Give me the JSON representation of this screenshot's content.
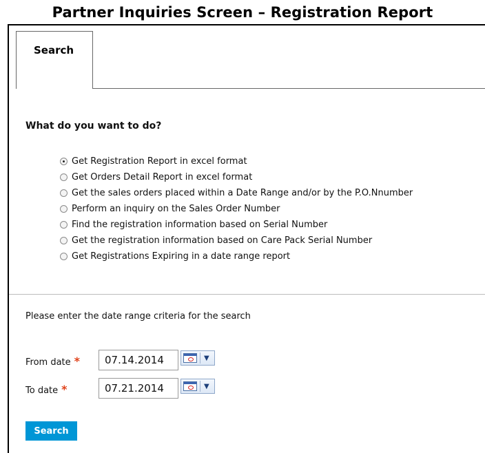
{
  "page_title": "Partner Inquiries Screen – Registration Report",
  "tabs": [
    {
      "label": "Search",
      "active": true
    }
  ],
  "question": "What do you want to do?",
  "options": [
    {
      "label": "Get Registration Report in excel format",
      "checked": true
    },
    {
      "label": "Get Orders Detail Report in excel format",
      "checked": false
    },
    {
      "label": "Get the sales orders placed within a Date Range and/or by the P.O.Nnumber",
      "checked": false
    },
    {
      "label": "Perform an inquiry on the Sales Order Number",
      "checked": false
    },
    {
      "label": "Find the registration information based on Serial Number",
      "checked": false
    },
    {
      "label": "Get the registration information based on Care Pack Serial Number",
      "checked": false
    },
    {
      "label": "Get Registrations Expiring in a date range report",
      "checked": false
    }
  ],
  "instruction": "Please enter the date range criteria for the search",
  "form": {
    "from": {
      "label": "From date",
      "required_mark": "*",
      "value": "07.14.2014",
      "calendar_icon": "calendar-icon"
    },
    "to": {
      "label": "To date",
      "required_mark": "*",
      "value": "07.21.2014",
      "calendar_icon": "calendar-icon"
    }
  },
  "search_button": "Search",
  "colors": {
    "accent": "#0096d6",
    "required": "#e0421a"
  }
}
